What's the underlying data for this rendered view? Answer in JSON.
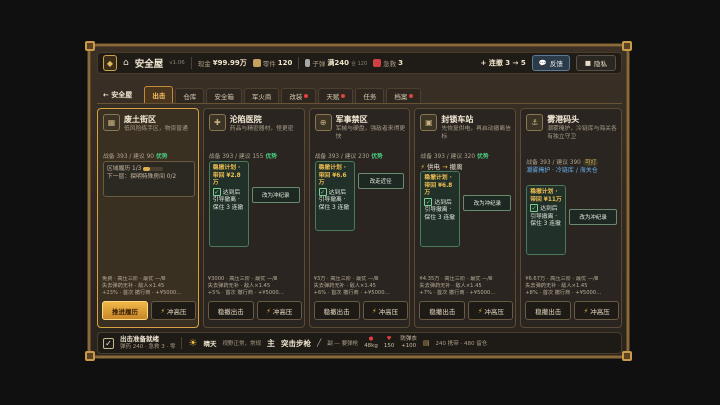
{
  "topbar": {
    "title": "安全屋",
    "version": "v1.06",
    "cash_label": "现金",
    "cash_value": "¥99.99万",
    "parts_label": "零件",
    "parts_value": "120",
    "ammo_label": "子弹",
    "ammo_value": "满240",
    "ammo_sub": "合 120",
    "medkit_label": "急救",
    "medkit_value": "3",
    "streak": "+ 连撤 3 → 5",
    "feedback_label": "反馈",
    "privacy_label": "隐私"
  },
  "tabs": {
    "back_label": "← 安全屋",
    "items": [
      {
        "label": "出击",
        "active": true,
        "dot": false
      },
      {
        "label": "仓库",
        "active": false,
        "dot": false
      },
      {
        "label": "安全箱",
        "active": false,
        "dot": false
      },
      {
        "label": "军火商",
        "active": false,
        "dot": false
      },
      {
        "label": "改装",
        "active": false,
        "dot": true
      },
      {
        "label": "天赋",
        "active": false,
        "dot": true
      },
      {
        "label": "任务",
        "active": false,
        "dot": false
      },
      {
        "label": "档案",
        "active": false,
        "dot": true
      }
    ]
  },
  "cards": [
    {
      "name": "废土街区",
      "desc": "低风险练手区，物资普通",
      "power": "战备 393 / 建议 90",
      "power_badge": "优势",
      "task_title": "区域履历 1/3",
      "task_next": "下一层：探明特殊房间 0/2",
      "task_progress": 0.33,
      "foot1": "免费 · 高压三阶 · 最优 —/Ⅲ",
      "foot2": "失去弹药无补 · 敌人×1.45",
      "foot3": "+23% · 首次 撤行商 · +¥5000…",
      "btn_main": "推进履历",
      "btn_charge": "冲高压"
    },
    {
      "name": "沦陷医院",
      "desc": "药品与精密器材，怪更密",
      "power": "战备 393 / 建议 155",
      "power_badge": "优势",
      "panel": "稳撤计划 · 带回 ¥2.8万",
      "panel_detail": "达到后引导撤离 · 保住 3 连撤",
      "side_btn": "改为冲纪录",
      "foot1": "¥3000 · 高压三阶 · 最优 —/Ⅲ",
      "foot2": "失去弹药无补 · 敌人×1.45",
      "foot3": "+5% · 首次 撤行商 · +¥5000…",
      "btn_main": "稳撤出击",
      "btn_charge": "冲高压"
    },
    {
      "name": "军事禁区",
      "desc": "军械与硬盘，强敌者来得更快",
      "power": "战备 393 / 建议 230",
      "power_badge": "优势",
      "panel": "稳撤计划 · 带回 ¥6.6万",
      "panel_detail": "达到后引导撤离 · 保住 3 连撤",
      "side_btn": "改走近径",
      "foot1": "¥3万 · 高压三阶 · 最优 —/Ⅲ",
      "foot2": "失去弹药无补 · 敌人×1.45",
      "foot3": "+6% · 首次 撤行商 · +¥5000…",
      "btn_main": "稳撤出击",
      "btn_charge": "冲高压"
    },
    {
      "name": "封锁车站",
      "desc": "先恢复供电，再启动撤离信标",
      "power": "战备 393 / 建议 320",
      "power_badge": "优势",
      "elec_a": "供电",
      "elec_b": "撤离",
      "panel": "稳撤计划 · 带回 ¥6.8万",
      "panel_detail": "达到后引导撤离 · 保住 3 连撤",
      "side_btn": "改为冲纪录",
      "foot1": "¥4.35万 · 高压三阶 · 最优 —/Ⅲ",
      "foot2": "失去弹药无补 · 敌人×1.45",
      "foot3": "+7% · 首次 撤行商 · +¥5000…",
      "btn_main": "稳撤出击",
      "btn_charge": "冲高压"
    },
    {
      "name": "雾港码头",
      "desc": "潮雾掩护，冷链库与海关各有独立守卫",
      "power": "战备 393 / 建议 390",
      "power_badge": "可打",
      "port": "潮雾掩护 · 冷链库 / 海关仓",
      "panel": "稳撤计划 · 带回 ¥11万",
      "panel_detail": "达到后引导撤离 · 保住 3 连撤",
      "side_btn": "改为冲纪录",
      "foot1": "¥6.67万 · 高压三阶 · 最优 —/Ⅲ",
      "foot2": "失去弹药无补 · 敌人×1.45",
      "foot3": "+8% · 首次 撤行商 · +¥5000…",
      "btn_main": "稳撤出击",
      "btn_charge": "冲高压"
    }
  ],
  "bottombar": {
    "title": "出击准备就绪",
    "sub": "弹药 240 · 急救 3 · 零",
    "weather": "晴天",
    "weather_sub": "视野正常，常规",
    "mode": "主",
    "weapon": "突击步枪",
    "backup": "副 — 要弹枪",
    "hp_value": "48kg",
    "hp_label": "150",
    "armor_value": "+100",
    "armor_label": "防弹衣",
    "carry": "240 携带 · 480 留仓"
  }
}
